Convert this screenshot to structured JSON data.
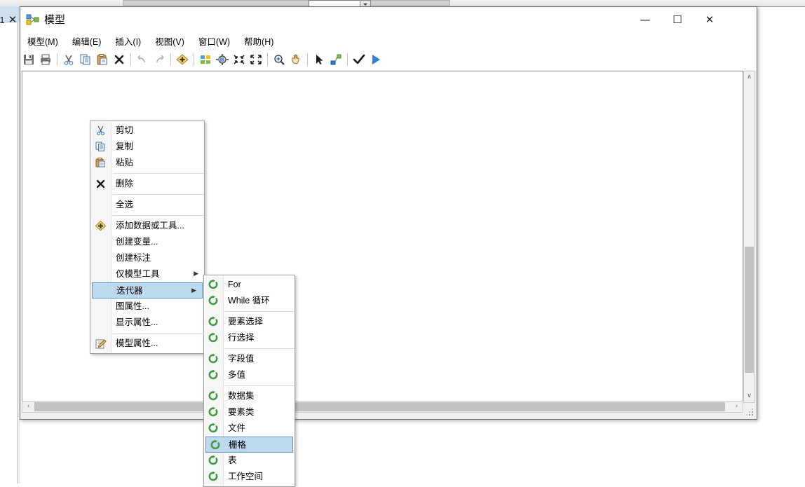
{
  "background": {
    "tab_close_label": "✕",
    "tab_index_label": "1"
  },
  "window": {
    "title": "模型",
    "icon": "model-builder-icon",
    "controls": {
      "minimize": "—",
      "maximize": "☐",
      "close": "✕"
    }
  },
  "menubar": {
    "items": [
      {
        "label": "模型(M)",
        "name": "menubar-item-model"
      },
      {
        "label": "编辑(E)",
        "name": "menubar-item-edit"
      },
      {
        "label": "插入(I)",
        "name": "menubar-item-insert"
      },
      {
        "label": "视图(V)",
        "name": "menubar-item-view"
      },
      {
        "label": "窗口(W)",
        "name": "menubar-item-window"
      },
      {
        "label": "帮助(H)",
        "name": "menubar-item-help"
      }
    ]
  },
  "toolbar": {
    "items": [
      {
        "icon": "save-icon"
      },
      {
        "icon": "print-icon"
      },
      {
        "icon": "separator"
      },
      {
        "icon": "cut-icon"
      },
      {
        "icon": "copy-icon"
      },
      {
        "icon": "paste-icon"
      },
      {
        "icon": "delete-icon"
      },
      {
        "icon": "separator"
      },
      {
        "icon": "undo-icon"
      },
      {
        "icon": "redo-icon"
      },
      {
        "icon": "separator"
      },
      {
        "icon": "add-data-icon"
      },
      {
        "icon": "separator"
      },
      {
        "icon": "auto-layout-icon"
      },
      {
        "icon": "fit-to-window-icon"
      },
      {
        "icon": "zoom-out-icon"
      },
      {
        "icon": "zoom-in-full-icon"
      },
      {
        "icon": "separator"
      },
      {
        "icon": "zoom-tool-icon"
      },
      {
        "icon": "pan-tool-icon"
      },
      {
        "icon": "separator"
      },
      {
        "icon": "select-tool-icon"
      },
      {
        "icon": "connect-tool-icon"
      },
      {
        "icon": "separator"
      },
      {
        "icon": "validate-icon"
      },
      {
        "icon": "run-icon"
      }
    ]
  },
  "context_menu": {
    "items": [
      {
        "label": "剪切",
        "icon": "cut-icon",
        "name": "context-menu-item-cut",
        "selected": false,
        "submenu": false,
        "sep_after": false
      },
      {
        "label": "复制",
        "icon": "copy-icon",
        "name": "context-menu-item-copy",
        "selected": false,
        "submenu": false,
        "sep_after": false
      },
      {
        "label": "粘贴",
        "icon": "paste-icon",
        "name": "context-menu-item-paste",
        "selected": false,
        "submenu": false,
        "sep_after": true
      },
      {
        "label": "删除",
        "icon": "delete-icon",
        "name": "context-menu-item-delete",
        "selected": false,
        "submenu": false,
        "sep_after": true
      },
      {
        "label": "全选",
        "icon": "",
        "name": "context-menu-item-select-all",
        "selected": false,
        "submenu": false,
        "sep_after": true
      },
      {
        "label": "添加数据或工具...",
        "icon": "add-data-icon",
        "name": "context-menu-item-add-data-or-tool",
        "selected": false,
        "submenu": false,
        "sep_after": false
      },
      {
        "label": "创建变量...",
        "icon": "",
        "name": "context-menu-item-create-variable",
        "selected": false,
        "submenu": false,
        "sep_after": false
      },
      {
        "label": "创建标注",
        "icon": "",
        "name": "context-menu-item-create-label",
        "selected": false,
        "submenu": false,
        "sep_after": false
      },
      {
        "label": "仅模型工具",
        "icon": "",
        "name": "context-menu-item-model-only-tools",
        "selected": false,
        "submenu": true,
        "sep_after": false
      },
      {
        "label": "迭代器",
        "icon": "",
        "name": "context-menu-item-iterators",
        "selected": true,
        "submenu": true,
        "sep_after": false
      },
      {
        "label": "图属性...",
        "icon": "",
        "name": "context-menu-item-diagram-properties",
        "selected": false,
        "submenu": false,
        "sep_after": false
      },
      {
        "label": "显示属性...",
        "icon": "",
        "name": "context-menu-item-display-properties",
        "selected": false,
        "submenu": false,
        "sep_after": true
      },
      {
        "label": "模型属性...",
        "icon": "model-properties-icon",
        "name": "context-menu-item-model-properties",
        "selected": false,
        "submenu": false,
        "sep_after": false
      }
    ]
  },
  "submenu": {
    "title": "迭代器",
    "items": [
      {
        "label": "For",
        "icon": "iterator-icon",
        "name": "submenu-item-for",
        "selected": false,
        "sep_after": false
      },
      {
        "label": "While 循环",
        "icon": "iterator-icon",
        "name": "submenu-item-while",
        "selected": false,
        "sep_after": true
      },
      {
        "label": "要素选择",
        "icon": "iterator-icon",
        "name": "submenu-item-feature-selection",
        "selected": false,
        "sep_after": false
      },
      {
        "label": "行选择",
        "icon": "iterator-icon",
        "name": "submenu-item-row-selection",
        "selected": false,
        "sep_after": true
      },
      {
        "label": "字段值",
        "icon": "iterator-icon",
        "name": "submenu-item-field-value",
        "selected": false,
        "sep_after": false
      },
      {
        "label": "多值",
        "icon": "iterator-icon",
        "name": "submenu-item-multivalue",
        "selected": false,
        "sep_after": true
      },
      {
        "label": "数据集",
        "icon": "iterator-icon",
        "name": "submenu-item-datasets",
        "selected": false,
        "sep_after": false
      },
      {
        "label": "要素类",
        "icon": "iterator-icon",
        "name": "submenu-item-feature-classes",
        "selected": false,
        "sep_after": false
      },
      {
        "label": "文件",
        "icon": "iterator-icon",
        "name": "submenu-item-files",
        "selected": false,
        "sep_after": false
      },
      {
        "label": "栅格",
        "icon": "iterator-icon",
        "name": "submenu-item-rasters",
        "selected": true,
        "sep_after": false
      },
      {
        "label": "表",
        "icon": "iterator-icon",
        "name": "submenu-item-tables",
        "selected": false,
        "sep_after": false
      },
      {
        "label": "工作空间",
        "icon": "iterator-icon",
        "name": "submenu-item-workspaces",
        "selected": false,
        "sep_after": false
      }
    ]
  },
  "scrollbars": {
    "vertical": {
      "up": "∧",
      "down": "∨"
    },
    "horizontal": {
      "left": "‹",
      "right": "›"
    }
  },
  "colors": {
    "highlight_fill": "#bdd9ee",
    "highlight_border": "#5a95cf",
    "window_bg": "#f0f0f0",
    "iterator_green": "#3f9a3f"
  }
}
